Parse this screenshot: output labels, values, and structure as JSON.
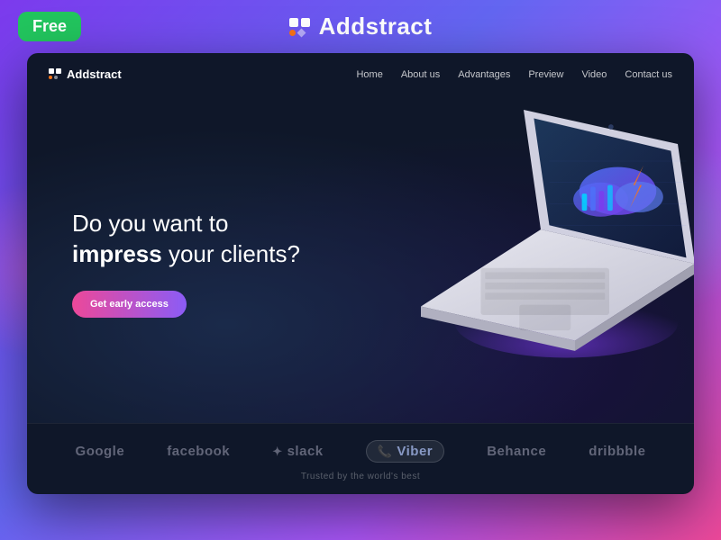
{
  "badge": {
    "label": "Free"
  },
  "header": {
    "logo_text": "Addstract"
  },
  "card": {
    "logo_text": "Addstract",
    "nav_links": [
      "Home",
      "About us",
      "Advantages",
      "Preview",
      "Video",
      "Contact us"
    ],
    "hero": {
      "title_line1": "Do you want to",
      "title_line2_normal": "your clients?",
      "title_line2_bold": "impress",
      "cta_label": "Get early access"
    },
    "brands": {
      "items": [
        "Google",
        "facebook",
        "slack",
        "Viber",
        "Behance",
        "dribbble"
      ],
      "trusted_text": "Trusted by the world's best"
    }
  }
}
